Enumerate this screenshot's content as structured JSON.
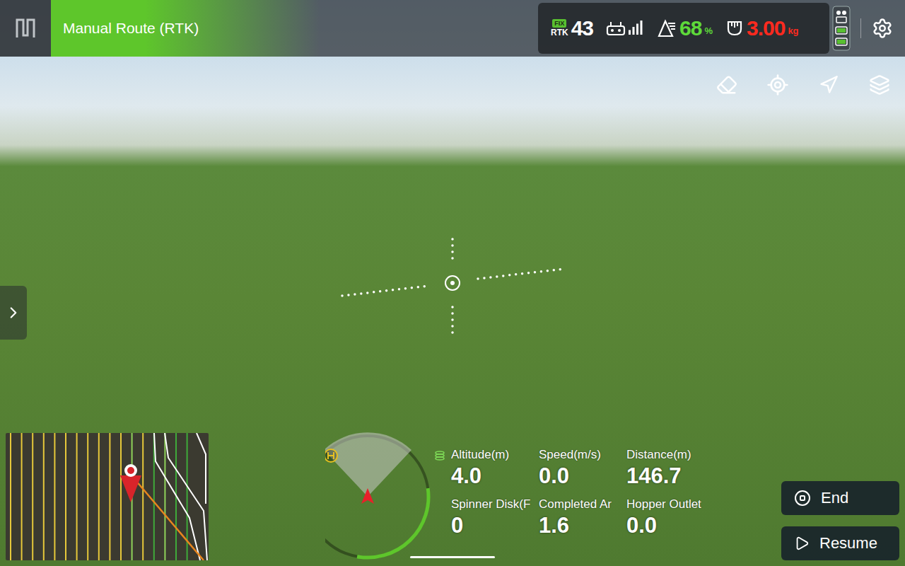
{
  "header": {
    "mode": "Manual Route (RTK)"
  },
  "status": {
    "rtk_badge": "FIX",
    "rtk_label": "RTK",
    "satellites": "43",
    "signal_level": 1,
    "battery": {
      "value": "68",
      "unit": "%",
      "warning": false
    },
    "payload": {
      "value": "3.00",
      "unit": "kg",
      "warning": true
    }
  },
  "telemetry": [
    {
      "label": "Altitude(m)",
      "value": "4.0"
    },
    {
      "label": "Speed(m/s)",
      "value": "0.0"
    },
    {
      "label": "Distance(m)",
      "value": "146.7"
    },
    {
      "label": "Spinner Disk(F",
      "value": "0"
    },
    {
      "label": "Completed Ar",
      "value": "1.6"
    },
    {
      "label": "Hopper Outlet",
      "value": "0.0"
    }
  ],
  "compass": {
    "arc_level": 0.3
  },
  "minimap": {
    "lines": [
      {
        "color": "#e6c83a"
      },
      {
        "color": "#e6c83a"
      },
      {
        "color": "#e6c83a"
      },
      {
        "color": "#e6c83a"
      },
      {
        "color": "#e6c83a"
      },
      {
        "color": "#e6c83a"
      },
      {
        "color": "#e6c83a"
      },
      {
        "color": "#e6c83a"
      },
      {
        "color": "#e6c83a"
      },
      {
        "color": "#e6c83a"
      },
      {
        "color": "#e6c83a"
      },
      {
        "color": "#8fd35a"
      },
      {
        "color": "#e6c83a"
      },
      {
        "color": "#3faa3a"
      },
      {
        "color": "#8fd35a"
      },
      {
        "color": "#3faa3a"
      },
      {
        "color": "#3faa3a"
      }
    ]
  },
  "buttons": [
    {
      "label": "End",
      "kind": "stop"
    },
    {
      "label": "Resume",
      "kind": "play"
    }
  ]
}
